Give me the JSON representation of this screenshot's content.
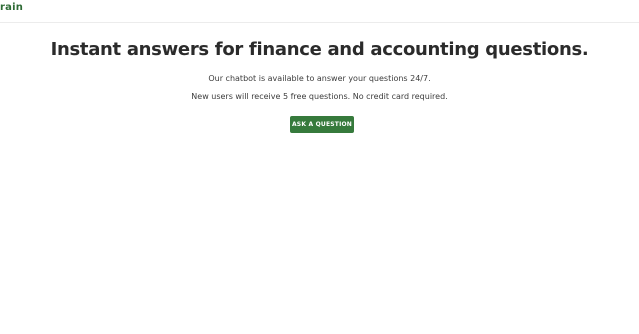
{
  "header": {
    "logo_text": "rain"
  },
  "hero": {
    "headline": "Instant answers for finance and accounting questions.",
    "line1": "Our chatbot is available to answer your questions 24/7.",
    "line2": "New users will receive 5 free questions. No credit card required.",
    "cta_label": "ASK A QUESTION"
  },
  "colors": {
    "brand_green": "#367a3c",
    "logo_green": "#2e6b35",
    "heading_text": "#2b2b2b"
  }
}
